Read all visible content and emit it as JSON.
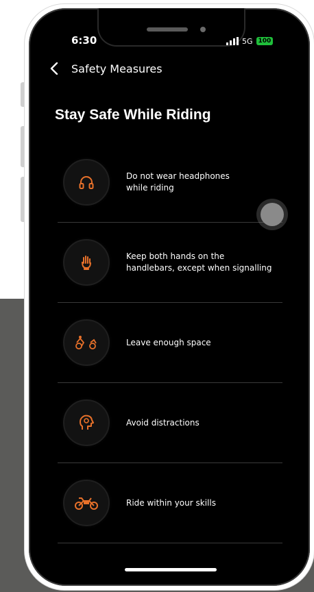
{
  "status_bar": {
    "time": "6:30",
    "network": "5G",
    "battery": "100"
  },
  "header": {
    "title": "Safety Measures"
  },
  "main": {
    "title": "Stay Safe While Riding",
    "measures": [
      {
        "icon": "headphones-icon",
        "text": "Do not wear headphones\nwhile riding"
      },
      {
        "icon": "hand-on-handlebar-icon",
        "text": "Keep both hands on the\nhandlebars, except when signalling"
      },
      {
        "icon": "spacing-icon",
        "text": "Leave enough space"
      },
      {
        "icon": "distraction-head-icon",
        "text": "Avoid distractions"
      },
      {
        "icon": "motorcycle-icon",
        "text": "Ride within your skills"
      }
    ]
  },
  "colors": {
    "accent": "#e8712a",
    "background": "#000000",
    "text": "#ffffff",
    "divider": "#3a3a3a"
  }
}
